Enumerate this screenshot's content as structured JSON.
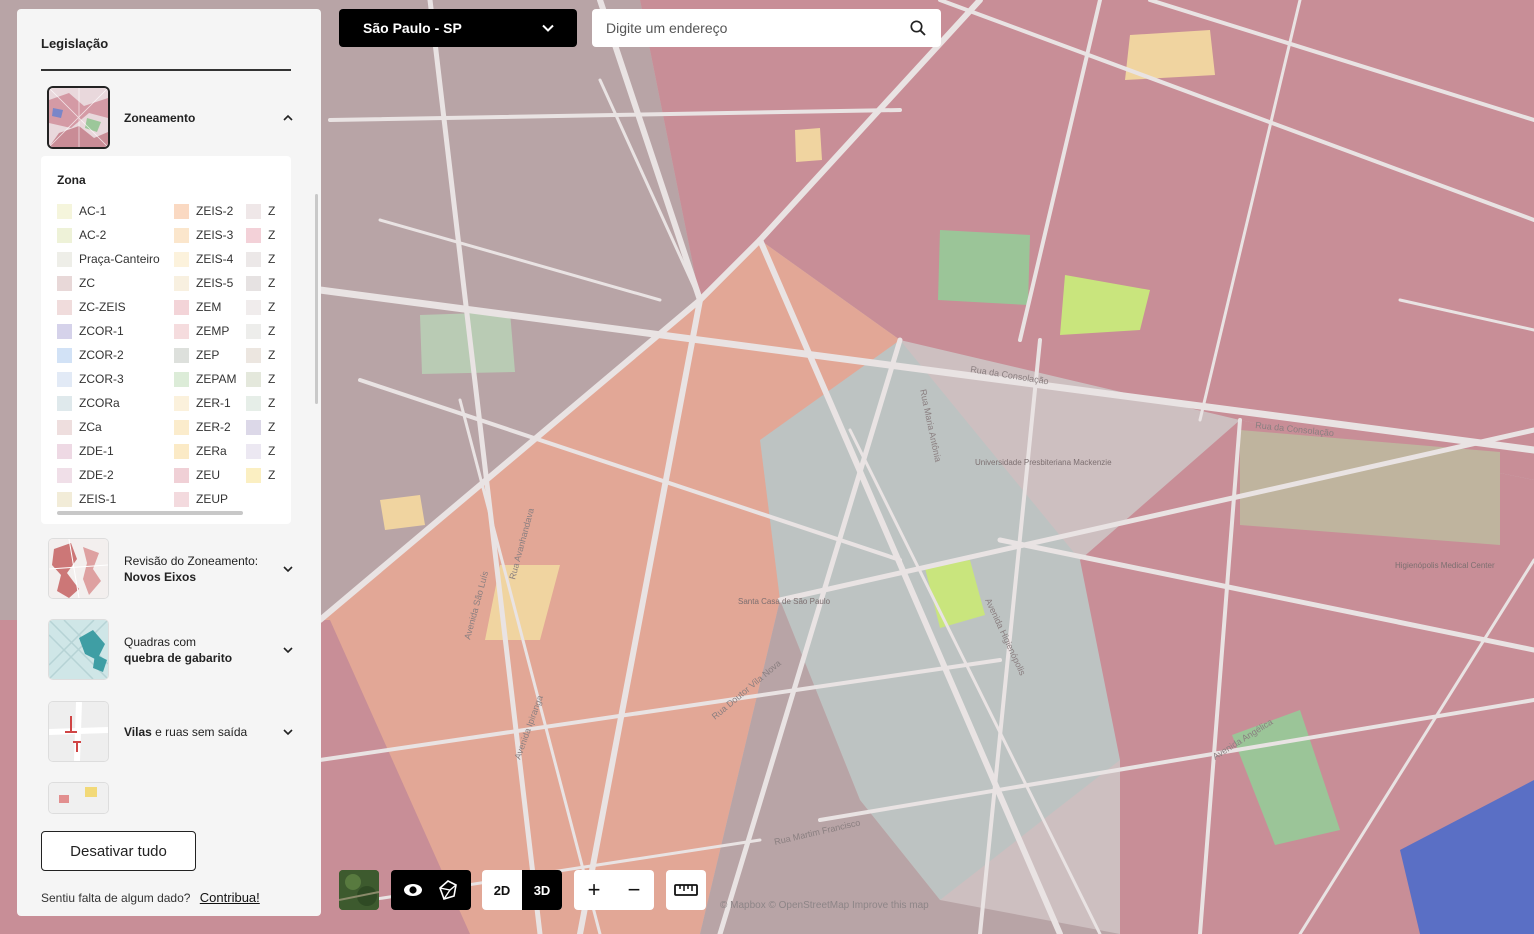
{
  "top_bar": {
    "city_select_value": "São Paulo - SP",
    "search_placeholder": "Digite um endereço"
  },
  "panel": {
    "title": "Legislação",
    "layers": [
      {
        "name": "Zoneamento",
        "expanded": true,
        "selected": true
      },
      {
        "name_prefix": "Revisão do Zoneamento: ",
        "name_bold": "Novos Eixos",
        "expanded": false
      },
      {
        "name_line1": "Quadras com",
        "name_line2": "quebra de gabarito",
        "expanded": false
      },
      {
        "name_bold": "Vilas",
        "name_rest": " e ruas sem saída",
        "expanded": false
      }
    ],
    "legend": {
      "heading": "Zona",
      "col1": [
        {
          "label": "AC-1",
          "color": "#f5f5dc"
        },
        {
          "label": "AC-2",
          "color": "#eef2d8"
        },
        {
          "label": "Praça-Canteiro",
          "color": "#eeeee8"
        },
        {
          "label": "ZC",
          "color": "#e8d8d8"
        },
        {
          "label": "ZC-ZEIS",
          "color": "#f0dcdc"
        },
        {
          "label": "ZCOR-1",
          "color": "#d5d2ea"
        },
        {
          "label": "ZCOR-2",
          "color": "#d2e2f6"
        },
        {
          "label": "ZCOR-3",
          "color": "#e2eaf6"
        },
        {
          "label": "ZCORa",
          "color": "#dfe9ec"
        },
        {
          "label": "ZCa",
          "color": "#eedede"
        },
        {
          "label": "ZDE-1",
          "color": "#eed9e4"
        },
        {
          "label": "ZDE-2",
          "color": "#f0dfe8"
        },
        {
          "label": "ZEIS-1",
          "color": "#f2ecd8"
        }
      ],
      "col2": [
        {
          "label": "ZEIS-2",
          "color": "#fad9c2"
        },
        {
          "label": "ZEIS-3",
          "color": "#fbe6cc"
        },
        {
          "label": "ZEIS-4",
          "color": "#fcf2dc"
        },
        {
          "label": "ZEIS-5",
          "color": "#f8f0e0"
        },
        {
          "label": "ZEM",
          "color": "#f3d4d8"
        },
        {
          "label": "ZEMP",
          "color": "#f5dcde"
        },
        {
          "label": "ZEP",
          "color": "#dde0dc"
        },
        {
          "label": "ZEPAM",
          "color": "#dcecd8"
        },
        {
          "label": "ZER-1",
          "color": "#fbf1dc"
        },
        {
          "label": "ZER-2",
          "color": "#fbeccc"
        },
        {
          "label": "ZERa",
          "color": "#fbeac6"
        },
        {
          "label": "ZEU",
          "color": "#f0d0d6"
        },
        {
          "label": "ZEUP",
          "color": "#f3dade"
        }
      ],
      "col3": [
        {
          "label": "Z",
          "color": "#efe7e8"
        },
        {
          "label": "Z",
          "color": "#f3d1d8"
        },
        {
          "label": "Z",
          "color": "#ece8e8"
        },
        {
          "label": "Z",
          "color": "#e6e2e2"
        },
        {
          "label": "Z",
          "color": "#f0ecec"
        },
        {
          "label": "Z",
          "color": "#ededeb"
        },
        {
          "label": "Z",
          "color": "#ece6e0"
        },
        {
          "label": "Z",
          "color": "#e4e8dc"
        },
        {
          "label": "Z",
          "color": "#e6eee8"
        },
        {
          "label": "Z",
          "color": "#dcd8e8"
        },
        {
          "label": "Z",
          "color": "#ece8f2"
        },
        {
          "label": "Z",
          "color": "#fbefc2"
        }
      ]
    },
    "deactivate_label": "Desativar tudo",
    "footer_text": "Sentiu falta de algum dado?",
    "contribute_label": "Contribua!"
  },
  "controls": {
    "dim_2d": "2D",
    "dim_3d": "3D",
    "active_dimension": "3D",
    "zoom_in": "+",
    "zoom_out": "−"
  },
  "map": {
    "attribution": "© Mapbox © OpenStreetMap Improve this map",
    "street_labels": [
      "Rua da Consolação",
      "Rua da Consolação",
      "Avenida Angélica",
      "Avenida Higienópolis",
      "Rua Maria Antônia",
      "Rua Doutor Vila Nova",
      "Avenida São Luís",
      "Rua Avanhandava",
      "Avenida Ipiranga",
      "Rua Martim Francisco"
    ],
    "poi_labels": [
      "Universidade Presbiteriana Mackenzie",
      "Santa Casa de São Paulo",
      "Higienópolis Medical Center"
    ],
    "colors": {
      "zeu": "#c88e97",
      "zm": "#b8a4a6",
      "zc": "#bfaaab",
      "zeis": "#e2a796",
      "zepam": "#9bc598",
      "park_lime": "#c9e57d",
      "zcor": "#5a6fc5",
      "zer": "#f0d4a0",
      "mackenzie": "#bfb49e",
      "street": "#e9e3e3"
    }
  }
}
